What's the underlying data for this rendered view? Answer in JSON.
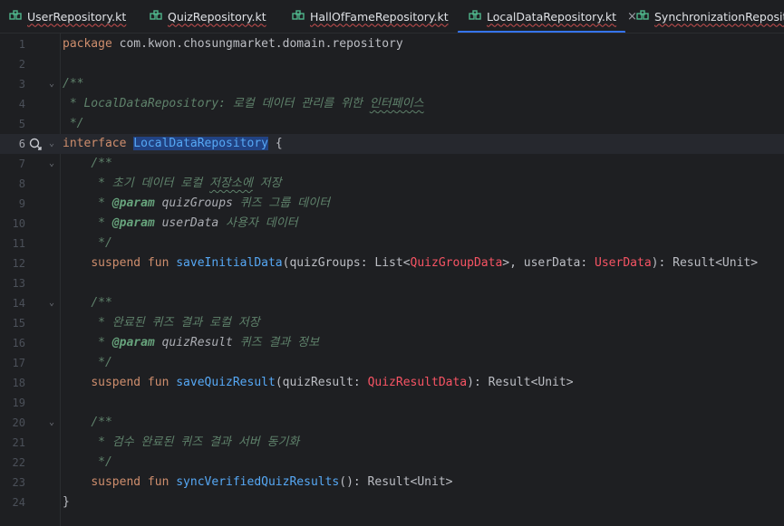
{
  "tabs": [
    {
      "label": "UserRepository.kt",
      "active": false
    },
    {
      "label": "QuizRepository.kt",
      "active": false
    },
    {
      "label": "HallOfFameRepository.kt",
      "active": false
    },
    {
      "label": "LocalDataRepository.kt",
      "active": true,
      "close": "×"
    },
    {
      "label": "SynchronizationRepository",
      "active": false
    }
  ],
  "colors": {
    "background": "#1e1f22",
    "keyword": "#cf8e6d",
    "doc_comment": "#5f826b",
    "function": "#56a8f5",
    "error_type": "#f75464",
    "active_tab_underline": "#3574f0",
    "selection": "#214283"
  },
  "icons": {
    "tab": "kotlin-file-icon",
    "gutter_line6": "implemented-interface-icon",
    "fold": "fold-chevron-icon"
  },
  "editor": {
    "current_line": 6,
    "lines": [
      {
        "n": "1",
        "t": [
          {
            "s": "package",
            "c": "kw"
          },
          {
            "s": " com.kwon.chosungmarket.domain.repository"
          }
        ]
      },
      {
        "n": "2",
        "t": []
      },
      {
        "n": "3",
        "fold": true,
        "t": [
          {
            "s": "/**",
            "c": "doc"
          }
        ]
      },
      {
        "n": "4",
        "t": [
          {
            "s": " * LocalDataRepository: 로컬 데이터 관리를 위한 ",
            "c": "doc"
          },
          {
            "s": "인터페이스",
            "c": "doc typo"
          }
        ]
      },
      {
        "n": "5",
        "t": [
          {
            "s": " */",
            "c": "doc"
          }
        ]
      },
      {
        "n": "6",
        "fold": true,
        "icon": true,
        "t": [
          {
            "s": "interface",
            "c": "kw"
          },
          {
            "s": " "
          },
          {
            "s": "LocalDataRepository",
            "c": "sel"
          },
          {
            "s": " {"
          }
        ]
      },
      {
        "n": "7",
        "fold": true,
        "t": [
          {
            "s": "    "
          },
          {
            "s": "/**",
            "c": "doc"
          }
        ]
      },
      {
        "n": "8",
        "t": [
          {
            "s": "     * 초기 데이터 로컬 ",
            "c": "doc"
          },
          {
            "s": "저장소에",
            "c": "doc typo"
          },
          {
            "s": " 저장",
            "c": "doc"
          }
        ]
      },
      {
        "n": "9",
        "t": [
          {
            "s": "     * ",
            "c": "doc"
          },
          {
            "s": "@param",
            "c": "tag"
          },
          {
            "s": " quizGroups",
            "c": "param"
          },
          {
            "s": " 퀴즈 그룹 데이터",
            "c": "doc"
          }
        ]
      },
      {
        "n": "10",
        "t": [
          {
            "s": "     * ",
            "c": "doc"
          },
          {
            "s": "@param",
            "c": "tag"
          },
          {
            "s": " userData",
            "c": "param"
          },
          {
            "s": " 사용자 데이터",
            "c": "doc"
          }
        ]
      },
      {
        "n": "11",
        "t": [
          {
            "s": "     */",
            "c": "doc"
          }
        ]
      },
      {
        "n": "12",
        "t": [
          {
            "s": "    "
          },
          {
            "s": "suspend fun",
            "c": "kw"
          },
          {
            "s": " "
          },
          {
            "s": "saveInitialData",
            "c": "fn"
          },
          {
            "s": "(quizGroups: List<"
          },
          {
            "s": "QuizGroupData",
            "c": "err"
          },
          {
            "s": ">, userData: "
          },
          {
            "s": "UserData",
            "c": "err"
          },
          {
            "s": "): Result<Unit>"
          }
        ]
      },
      {
        "n": "13",
        "t": []
      },
      {
        "n": "14",
        "fold": true,
        "t": [
          {
            "s": "    "
          },
          {
            "s": "/**",
            "c": "doc"
          }
        ]
      },
      {
        "n": "15",
        "t": [
          {
            "s": "     * 완료된 퀴즈 결과 로컬 저장",
            "c": "doc"
          }
        ]
      },
      {
        "n": "16",
        "t": [
          {
            "s": "     * ",
            "c": "doc"
          },
          {
            "s": "@param",
            "c": "tag"
          },
          {
            "s": " quizResult",
            "c": "param"
          },
          {
            "s": " 퀴즈 결과 정보",
            "c": "doc"
          }
        ]
      },
      {
        "n": "17",
        "t": [
          {
            "s": "     */",
            "c": "doc"
          }
        ]
      },
      {
        "n": "18",
        "t": [
          {
            "s": "    "
          },
          {
            "s": "suspend fun",
            "c": "kw"
          },
          {
            "s": " "
          },
          {
            "s": "saveQuizResult",
            "c": "fn"
          },
          {
            "s": "(quizResult: "
          },
          {
            "s": "QuizResultData",
            "c": "err"
          },
          {
            "s": "): Result<Unit>"
          }
        ]
      },
      {
        "n": "19",
        "t": []
      },
      {
        "n": "20",
        "fold": true,
        "t": [
          {
            "s": "    "
          },
          {
            "s": "/**",
            "c": "doc"
          }
        ]
      },
      {
        "n": "21",
        "t": [
          {
            "s": "     * 검수 완료된 퀴즈 결과 서버 동기화",
            "c": "doc"
          }
        ]
      },
      {
        "n": "22",
        "t": [
          {
            "s": "     */",
            "c": "doc"
          }
        ]
      },
      {
        "n": "23",
        "t": [
          {
            "s": "    "
          },
          {
            "s": "suspend fun",
            "c": "kw"
          },
          {
            "s": " "
          },
          {
            "s": "syncVerifiedQuizResults",
            "c": "fn"
          },
          {
            "s": "(): Result<Unit>"
          }
        ]
      },
      {
        "n": "24",
        "t": [
          {
            "s": "}"
          }
        ]
      }
    ]
  }
}
